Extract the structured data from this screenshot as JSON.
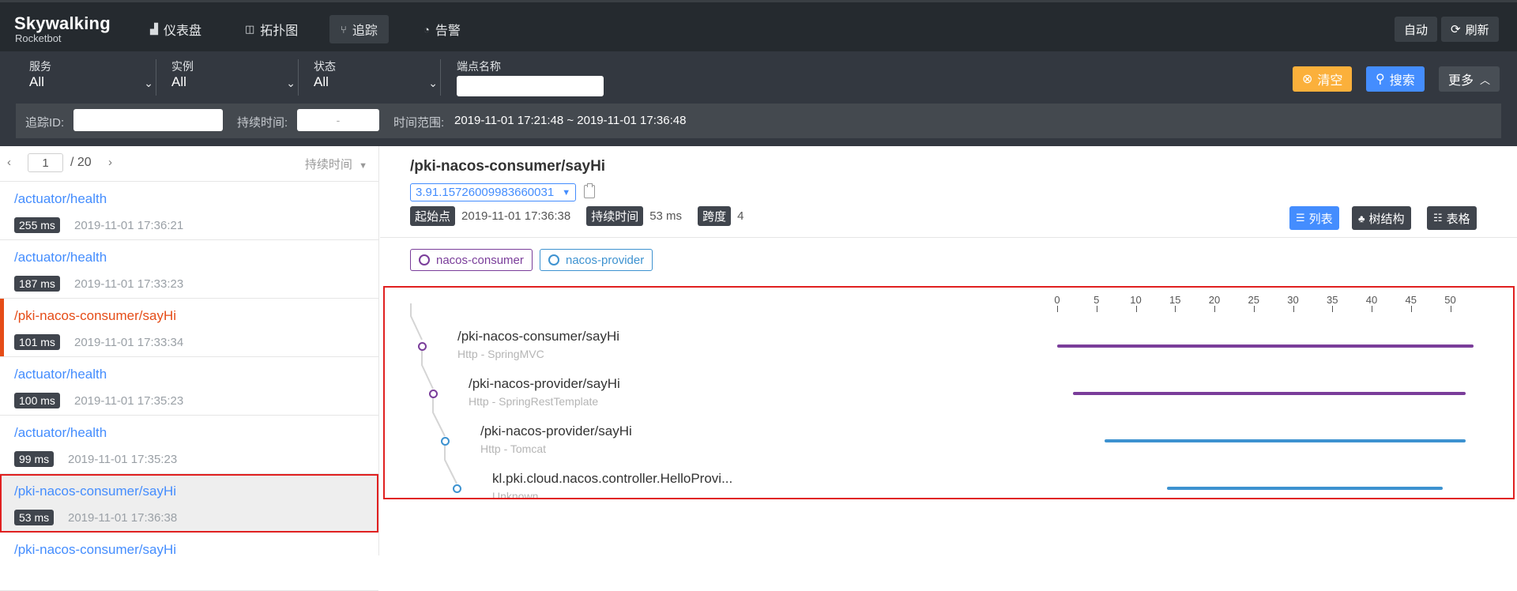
{
  "app": {
    "logo_top": "Skywalking",
    "logo_bottom": "Rocketbot"
  },
  "nav": [
    {
      "label": "仪表盘",
      "icon": "bar-chart-icon"
    },
    {
      "label": "拓扑图",
      "icon": "topology-icon"
    },
    {
      "label": "追踪",
      "icon": "trace-icon",
      "active": true
    },
    {
      "label": "告警",
      "icon": "alarm-icon"
    }
  ],
  "header_actions": {
    "auto_label": "自动",
    "refresh_label": "刷新"
  },
  "filters": {
    "service": {
      "label": "服务",
      "value": "All"
    },
    "instance": {
      "label": "实例",
      "value": "All"
    },
    "status": {
      "label": "状态",
      "value": "All"
    },
    "endpoint": {
      "label": "端点名称",
      "value": ""
    },
    "clear_label": "清空",
    "search_label": "搜索",
    "more_label": "更多",
    "trace_id_label": "追踪ID:",
    "duration_label": "持续时间:",
    "duration_sep": "-",
    "time_range_label": "时间范围:",
    "time_range_value": "2019-11-01 17:21:48 ~ 2019-11-01 17:36:48"
  },
  "pager": {
    "page": "1",
    "total": "/ 20",
    "sort_label": "持续时间"
  },
  "traces": [
    {
      "name": "/actuator/health",
      "duration": "255 ms",
      "time": "2019-11-01 17:36:21",
      "error": false,
      "selected": false
    },
    {
      "name": "/actuator/health",
      "duration": "187 ms",
      "time": "2019-11-01 17:33:23",
      "error": false,
      "selected": false
    },
    {
      "name": "/pki-nacos-consumer/sayHi",
      "duration": "101 ms",
      "time": "2019-11-01 17:33:34",
      "error": true,
      "selected": false
    },
    {
      "name": "/actuator/health",
      "duration": "100 ms",
      "time": "2019-11-01 17:35:23",
      "error": false,
      "selected": false
    },
    {
      "name": "/actuator/health",
      "duration": "99 ms",
      "time": "2019-11-01 17:35:23",
      "error": false,
      "selected": false
    },
    {
      "name": "/pki-nacos-consumer/sayHi",
      "duration": "53 ms",
      "time": "2019-11-01 17:36:38",
      "error": false,
      "selected": true
    },
    {
      "name": "/pki-nacos-consumer/sayHi",
      "duration": "",
      "time": "",
      "error": false,
      "selected": false
    }
  ],
  "detail": {
    "title": "/pki-nacos-consumer/sayHi",
    "trace_id": "3.91.15726009983660031",
    "start_label": "起始点",
    "start_value": "2019-11-01 17:36:38",
    "duration_label": "持续时间",
    "duration_value": "53 ms",
    "spans_label": "跨度",
    "spans_value": "4",
    "view_list": "列表",
    "view_tree": "树结构",
    "view_table": "表格"
  },
  "services": [
    {
      "name": "nacos-consumer",
      "color": "#7a3d9a"
    },
    {
      "name": "nacos-provider",
      "color": "#3d92d0"
    }
  ],
  "timeline": {
    "ticks": [
      "0",
      "5",
      "10",
      "15",
      "20",
      "25",
      "30",
      "35",
      "40",
      "45",
      "50"
    ],
    "max": 53
  },
  "spans": [
    {
      "name": "/pki-nacos-consumer/sayHi",
      "sub": "Http - SpringMVC",
      "start": 0,
      "end": 53,
      "color": "#7a3d9a",
      "depth": 0
    },
    {
      "name": "/pki-nacos-provider/sayHi",
      "sub": "Http - SpringRestTemplate",
      "start": 2,
      "end": 52,
      "color": "#7a3d9a",
      "depth": 1
    },
    {
      "name": "/pki-nacos-provider/sayHi",
      "sub": "Http - Tomcat",
      "start": 6,
      "end": 52,
      "color": "#3d92d0",
      "depth": 2
    },
    {
      "name": "kl.pki.cloud.nacos.controller.HelloProvi...",
      "sub": "Unknown",
      "start": 14,
      "end": 49,
      "color": "#3d92d0",
      "depth": 3
    }
  ]
}
